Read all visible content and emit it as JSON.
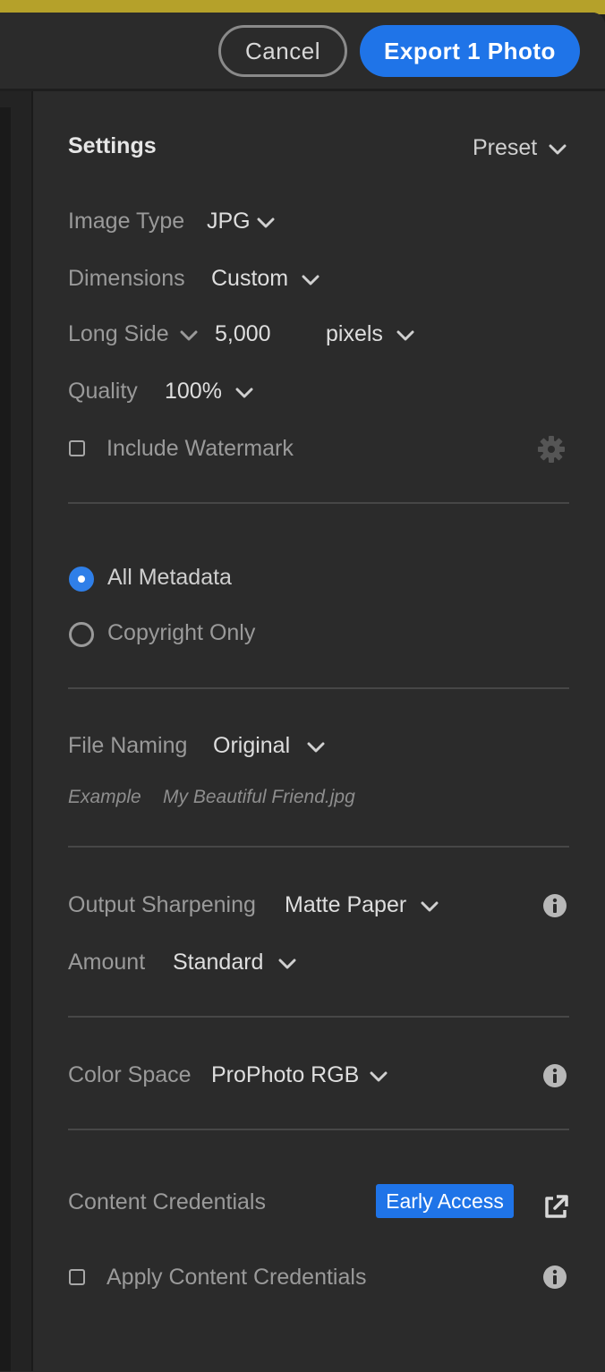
{
  "header": {
    "cancel_label": "Cancel",
    "export_label": "Export 1 Photo"
  },
  "settings": {
    "title": "Settings",
    "preset_label": "Preset",
    "image_type": {
      "label": "Image Type",
      "value": "JPG"
    },
    "dimensions": {
      "label": "Dimensions",
      "value": "Custom"
    },
    "long_side": {
      "label": "Long Side",
      "value": "5,000",
      "unit": "pixels"
    },
    "quality": {
      "label": "Quality",
      "value": "100%"
    },
    "watermark": {
      "label": "Include Watermark",
      "checked": false
    }
  },
  "metadata": {
    "options": [
      {
        "label": "All Metadata",
        "selected": true
      },
      {
        "label": "Copyright Only",
        "selected": false
      }
    ]
  },
  "file_naming": {
    "label": "File Naming",
    "value": "Original",
    "example_label": "Example",
    "example_value": "My Beautiful Friend.jpg"
  },
  "sharpening": {
    "label": "Output Sharpening",
    "value": "Matte Paper",
    "amount_label": "Amount",
    "amount_value": "Standard"
  },
  "color_space": {
    "label": "Color Space",
    "value": "ProPhoto RGB"
  },
  "content_credentials": {
    "label": "Content Credentials",
    "badge": "Early Access",
    "apply_label": "Apply Content Credentials",
    "apply_checked": false
  },
  "colors": {
    "accent": "#1f74e8",
    "panel": "#2b2b2b",
    "topbar": "#b5a12a"
  },
  "icons": [
    "chevron-down-icon",
    "gear-icon",
    "info-icon",
    "external-link-icon"
  ]
}
